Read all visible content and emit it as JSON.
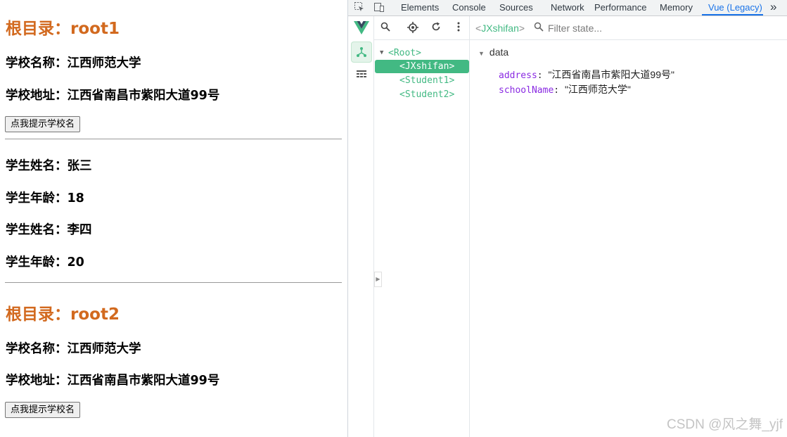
{
  "page": {
    "root1": {
      "title": "根目录：root1",
      "school_name": "学校名称：江西师范大学",
      "school_address": "学校地址：江西省南昌市紫阳大道99号",
      "button": "点我提示学校名"
    },
    "students": [
      {
        "name": "学生姓名：张三",
        "age": "学生年龄：18"
      },
      {
        "name": "学生姓名：李四",
        "age": "学生年龄：20"
      }
    ],
    "root2": {
      "title": "根目录：root2",
      "school_name": "学校名称：江西师范大学",
      "school_address": "学校地址：江西省南昌市紫阳大道99号",
      "button": "点我提示学校名"
    }
  },
  "devtools": {
    "tabs": [
      "Elements",
      "Console",
      "Sources",
      "Network",
      "Performance",
      "Memory",
      "Vue (Legacy)"
    ],
    "active_tab": "Vue (Legacy)",
    "more_tabs": "»",
    "tree": [
      {
        "label": "<Root>",
        "expanded": true,
        "selected": false
      },
      {
        "label": "<JXshifan>",
        "selected": true
      },
      {
        "label": "<Student1>",
        "selected": false
      },
      {
        "label": "<Student2>",
        "selected": false
      }
    ],
    "inspector": {
      "component": "JXshifan",
      "filter_placeholder": "Filter state...",
      "section": "data",
      "props": [
        {
          "key": "address",
          "value": "\"江西省南昌市紫阳大道99号\""
        },
        {
          "key": "schoolName",
          "value": "\"江西师范大学\""
        }
      ]
    },
    "accent_color": "#42b983",
    "active_tab_color": "#1a73e8"
  },
  "watermark": "CSDN @风之舞_yjf"
}
